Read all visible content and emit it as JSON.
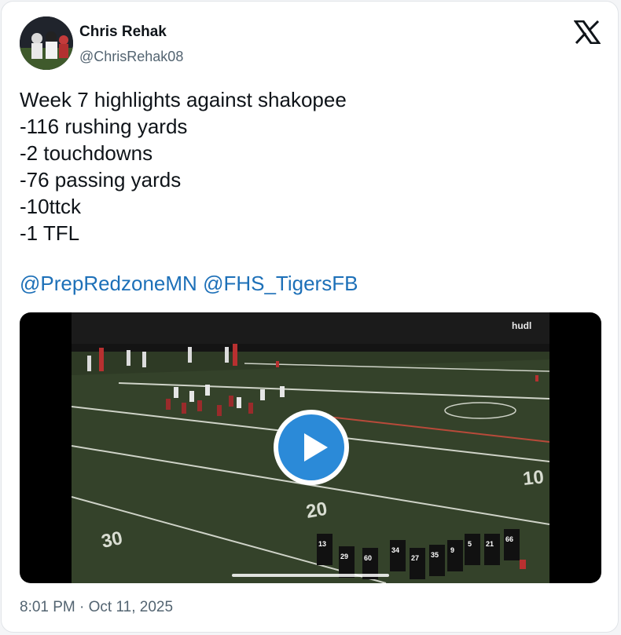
{
  "author": {
    "name": "Chris Rehak",
    "handle": "@ChrisRehak08"
  },
  "platform_icon": "x-logo-icon",
  "tweet": {
    "lines": [
      "Week 7 highlights against shakopee",
      "-116 rushing yards",
      "-2 touchdowns",
      "-76 passing yards",
      "-10ttck",
      "-1 TFL"
    ],
    "mentions": [
      "@PrepRedzoneMN",
      "@FHS_TigersFB"
    ]
  },
  "video": {
    "watermark": "hudl",
    "play_icon": "play-icon",
    "field_numbers": [
      "30",
      "20",
      "10"
    ],
    "jersey_numbers": [
      "13",
      "29",
      "60",
      "34",
      "27",
      "35",
      "9",
      "5",
      "21",
      "66"
    ]
  },
  "timestamp": "8:01 PM · Oct 11, 2025",
  "colors": {
    "link": "#1d70b8",
    "play_button": "#2b8ad8",
    "text": "#0f1419",
    "secondary_text": "#536471"
  }
}
